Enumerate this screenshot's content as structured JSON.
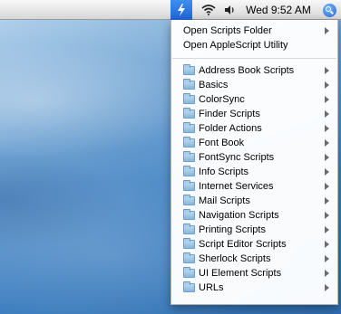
{
  "menubar": {
    "clock": "Wed 9:52 AM",
    "icons": {
      "script_menu": "script-menu-icon",
      "wifi": "wifi-icon",
      "volume": "volume-icon",
      "spotlight": "spotlight-icon"
    }
  },
  "menu": {
    "top_items": [
      {
        "label": "Open Scripts Folder",
        "has_submenu": true
      },
      {
        "label": "Open AppleScript Utility",
        "has_submenu": false
      }
    ],
    "folders": [
      {
        "label": "Address Book Scripts"
      },
      {
        "label": "Basics"
      },
      {
        "label": "ColorSync"
      },
      {
        "label": "Finder Scripts"
      },
      {
        "label": "Folder Actions"
      },
      {
        "label": "Font Book"
      },
      {
        "label": "FontSync Scripts"
      },
      {
        "label": "Info Scripts"
      },
      {
        "label": "Internet Services"
      },
      {
        "label": "Mail Scripts"
      },
      {
        "label": "Navigation Scripts"
      },
      {
        "label": "Printing Scripts"
      },
      {
        "label": "Script Editor Scripts"
      },
      {
        "label": "Sherlock Scripts"
      },
      {
        "label": "UI Element Scripts"
      },
      {
        "label": "URLs"
      }
    ]
  }
}
